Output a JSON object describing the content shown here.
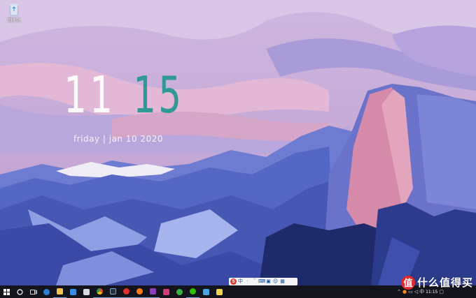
{
  "desktop": {
    "icons": [
      {
        "label": "回收站",
        "icon": "recycle-bin-icon"
      }
    ]
  },
  "clock_widget": {
    "hours": "11",
    "minutes": "15",
    "date": "friday | jan 10 2020",
    "hour_color": "#ffffff",
    "minute_color": "#2f9a95"
  },
  "ime_toolbar": {
    "logo": "S",
    "mode": "中",
    "items": [
      "·",
      "ˇ",
      "⌨",
      "▣",
      "☺",
      "▦"
    ]
  },
  "taskbar": {
    "pinned": [
      "start-icon",
      "search-icon",
      "task-view-icon",
      "edge-icon",
      "file-explorer-icon",
      "store-icon",
      "mail-icon",
      "chrome-icon",
      "terminal-icon",
      "music-icon",
      "onenote-icon",
      "app-icon",
      "browser-icon",
      "wechat-icon"
    ],
    "tray_time": "11:15"
  },
  "watermark": {
    "badge": "值",
    "text": "什么值得买"
  },
  "colors": {
    "taskbar_bg": "#14141c",
    "sky": "#c9b6d8",
    "mountain_blue": "#4a5fb8",
    "rock_pink": "#d48aa8"
  }
}
